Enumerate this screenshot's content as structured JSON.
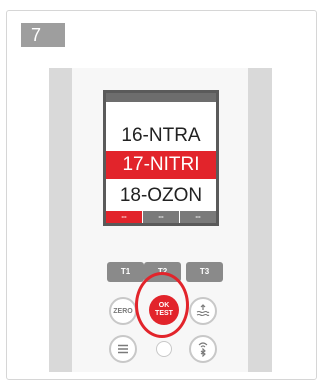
{
  "step_number": "7",
  "display": {
    "menu_items": [
      "16-NTRA",
      "17-NITRI",
      "18-OZON"
    ],
    "selected_index": 1,
    "slots": [
      "--",
      "--",
      "--"
    ],
    "active_slot_index": 0
  },
  "buttons": {
    "t1": "T1",
    "t2": "T2",
    "t3": "T3",
    "zero": "ZERO",
    "ok_line1": "OK",
    "ok_line2": "TEST"
  },
  "icons": {
    "wave": "water-wave-icon",
    "menu": "menu-icon",
    "light": "light-sensor-icon",
    "bluetooth": "bluetooth-icon"
  },
  "colors": {
    "accent": "#e2242b",
    "step_badge": "#9e9e9e",
    "button_grey": "#8a8a8a"
  }
}
